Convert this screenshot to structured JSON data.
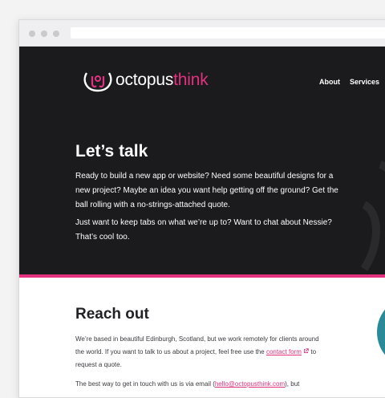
{
  "logo": {
    "word1": "octopus",
    "word2": "think"
  },
  "nav": {
    "about": "About",
    "services": "Services"
  },
  "hero": {
    "title": "Let’s talk",
    "para1": "Ready to build a new app or website? Need some beautiful designs for a new project? Maybe an idea you want help getting off the ground? Get the ball rolling with a no-strings-attached quote.",
    "para2": "Just want to keep tabs on what we’re up to? Want to chat about Nessie? That’s cool too."
  },
  "reach": {
    "title": "Reach out",
    "para1_text": "We’re based in beautiful Edinburgh, Scotland, but we work remotely for clients around the world. If you want to talk to us about a project, feel free use the",
    "contact_link": "contact form",
    "para1_end": "to request a quote.",
    "para2_text": "The best way to get in touch with us is via email (",
    "email_link": "hello@octopusthink.com",
    "para2_end": "), but"
  },
  "colors": {
    "brand": "#e2317f",
    "dark": "#1b1b1d",
    "teal": "#2a8a97"
  },
  "icons": {
    "logo": "octopus-logo-icon",
    "external": "external-link-icon"
  }
}
